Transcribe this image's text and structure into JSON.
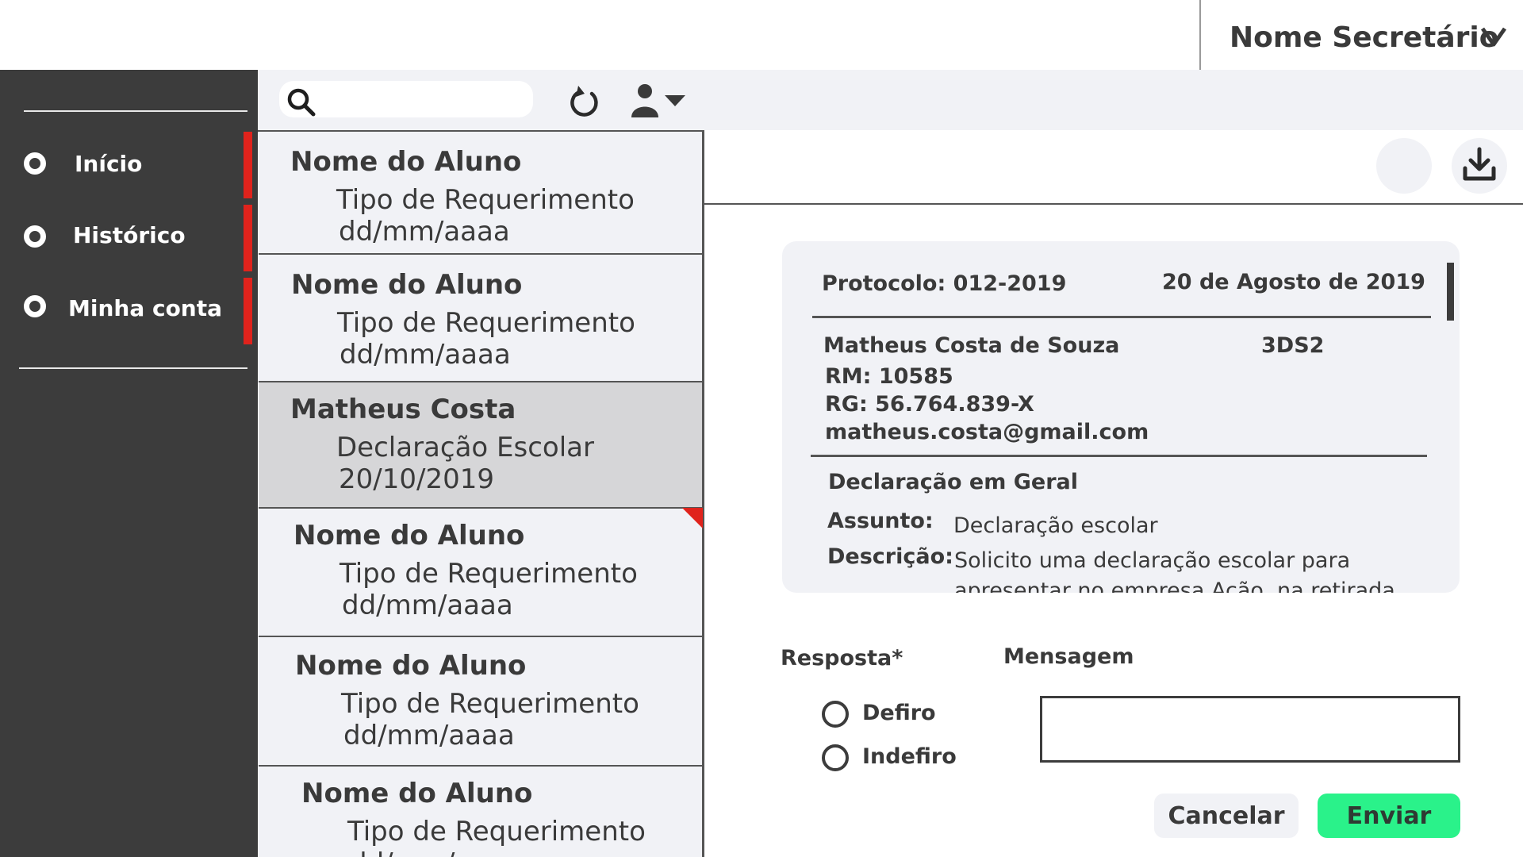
{
  "header": {
    "user_name": "Nome Secretário",
    "user_menu_icon": "chevron-down-icon"
  },
  "sidebar": {
    "items": [
      {
        "label": "Início",
        "icon": "ring-icon",
        "active": true
      },
      {
        "label": "Histórico",
        "icon": "ring-icon",
        "active": true
      },
      {
        "label": "Minha conta",
        "icon": "ring-icon",
        "active": true
      }
    ]
  },
  "toolbar": {
    "search_value": "",
    "search_icon": "search-icon",
    "refresh_icon": "refresh-icon",
    "filter_icon": "user-filter-icon"
  },
  "list": {
    "items": [
      {
        "name": "Nome do Aluno",
        "type": "Tipo de Requerimento",
        "date": "dd/mm/aaaa"
      },
      {
        "name": "Nome do Aluno",
        "type": "Tipo de Requerimento",
        "date": "dd/mm/aaaa"
      },
      {
        "name": "Matheus Costa",
        "type": "Declaração Escolar",
        "date": "20/10/2019",
        "selected": true
      },
      {
        "name": "Nome do Aluno",
        "type": "Tipo de Requerimento",
        "date": "dd/mm/aaaa",
        "flagged": true
      },
      {
        "name": "Nome do Aluno",
        "type": "Tipo de Requerimento",
        "date": "dd/mm/aaaa"
      },
      {
        "name": "Nome do Aluno",
        "type": "Tipo de Requerimento",
        "date": "dd/mm/aaaa"
      }
    ]
  },
  "detail": {
    "protocol": "Protocolo: 012-2019",
    "date": "20 de Agosto de 2019",
    "student_name": "Matheus Costa de Souza",
    "class": "3DS2",
    "rm": "RM: 10585",
    "rg": "RG: 56.764.839-X",
    "email": "matheus.costa@gmail.com",
    "category": "Declaração em Geral",
    "subject_label": "Assunto:",
    "subject_value": "Declaração escolar",
    "description_label": "Descrição:",
    "description_line1": "Solicito uma declaração escolar para",
    "description_line2": "apresentar no empresa Ação, na retirada",
    "download_icon": "download-icon"
  },
  "response": {
    "label": "Resposta*",
    "options": [
      "Defiro",
      "Indefiro"
    ],
    "message_label": "Mensagem",
    "message_value": "",
    "cancel_label": "Cancelar",
    "send_label": "Enviar"
  },
  "colors": {
    "sidebar_bg": "#3c3c3c",
    "accent_red": "#e0231c",
    "send_green": "#2af28a",
    "panel_bg": "#f1f2f6",
    "selected_bg": "#d6d6d8"
  }
}
